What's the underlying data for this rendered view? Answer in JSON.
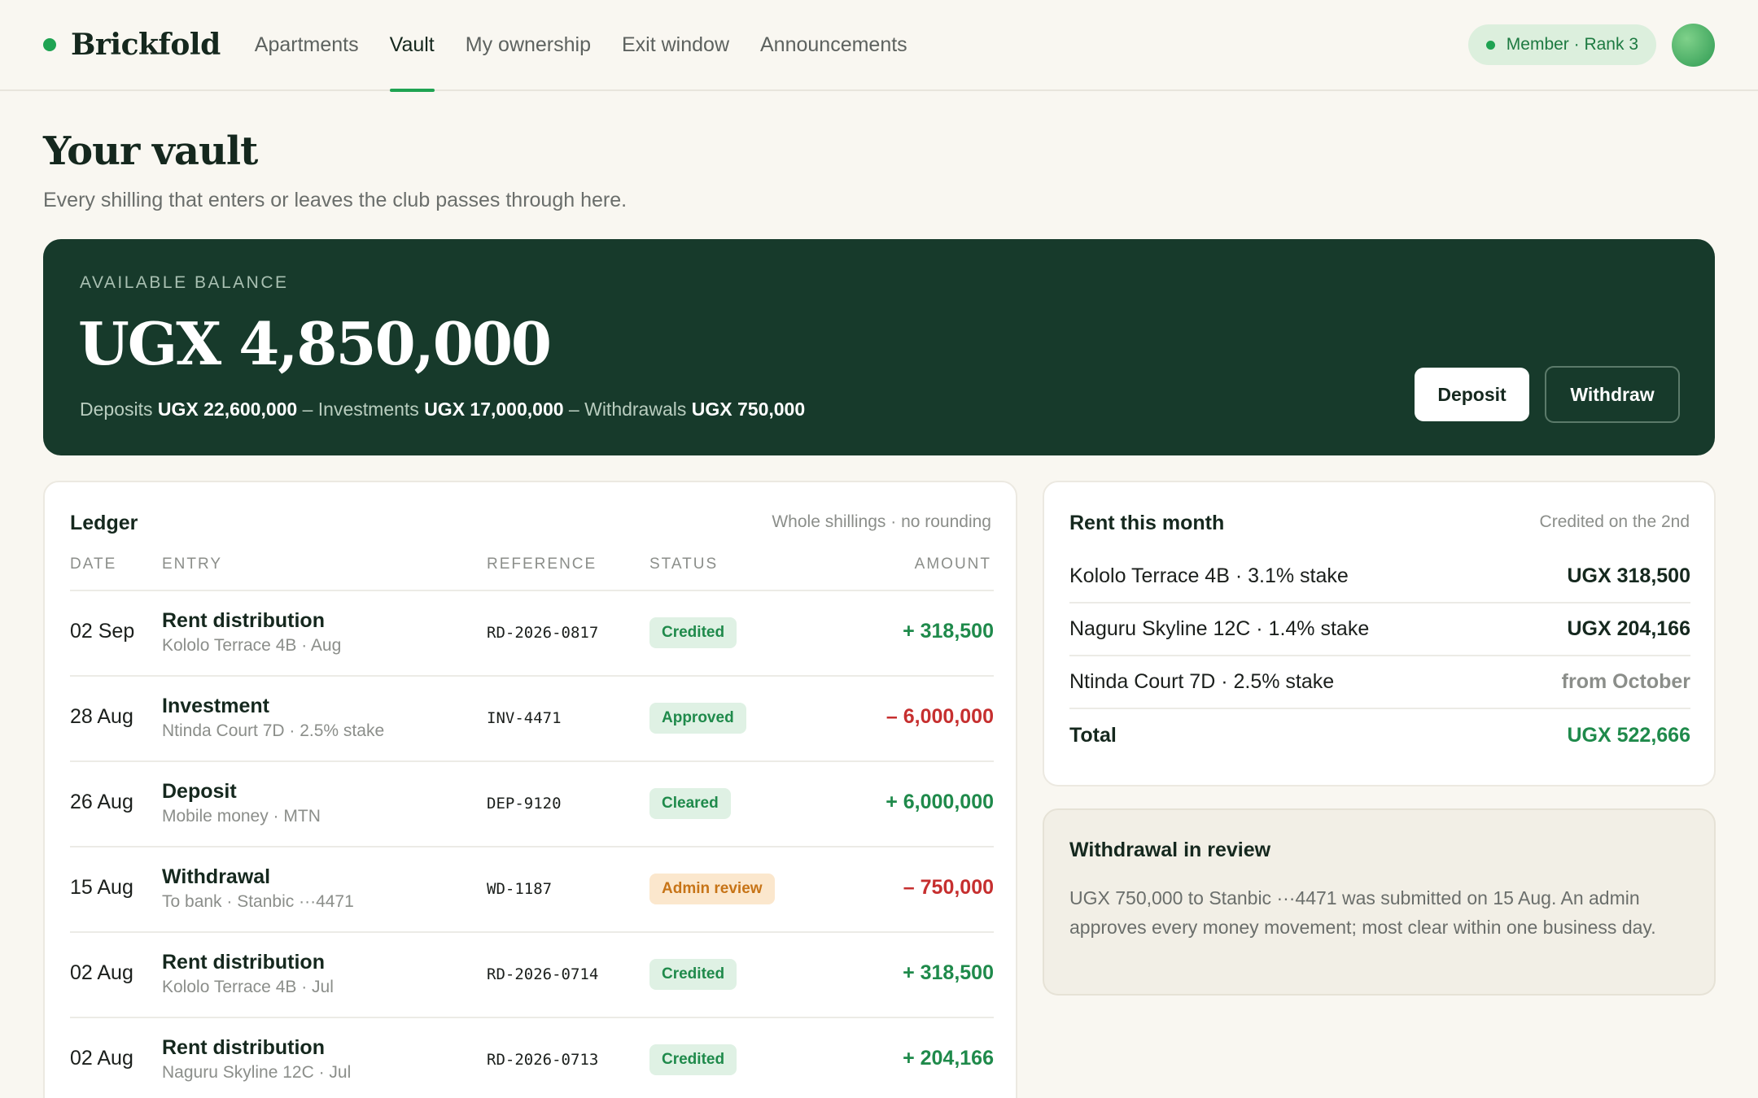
{
  "brand": {
    "name": "Brickfold"
  },
  "nav": {
    "items": [
      {
        "label": "Apartments"
      },
      {
        "label": "Vault"
      },
      {
        "label": "My ownership"
      },
      {
        "label": "Exit window"
      },
      {
        "label": "Announcements"
      }
    ],
    "active": "Vault"
  },
  "member": {
    "badge": "Member · Rank 3"
  },
  "page": {
    "title": "Your vault",
    "subtitle": "Every shilling that enters or leaves the club passes through here."
  },
  "balance": {
    "label": "AVAILABLE BALANCE",
    "amount": "UGX 4,850,000",
    "deposits_label": "Deposits",
    "deposits_value": "UGX 22,600,000",
    "investments_label": "Investments",
    "investments_value": "UGX 17,000,000",
    "withdrawals_label": "Withdrawals",
    "withdrawals_value": "UGX 750,000",
    "separator": "–",
    "deposit_button": "Deposit",
    "withdraw_button": "Withdraw"
  },
  "ledger": {
    "title": "Ledger",
    "note": "Whole shillings · no rounding",
    "columns": {
      "date": "DATE",
      "entry": "ENTRY",
      "reference": "REFERENCE",
      "status": "STATUS",
      "amount": "AMOUNT"
    },
    "rows": [
      {
        "date": "02 Sep",
        "title": "Rent distribution",
        "sub": "Kololo Terrace 4B · Aug",
        "ref": "RD-2026-0817",
        "status": "Credited",
        "amount": "+ 318,500"
      },
      {
        "date": "28 Aug",
        "title": "Investment",
        "sub": "Ntinda Court 7D · 2.5% stake",
        "ref": "INV-4471",
        "status": "Approved",
        "amount": "– 6,000,000"
      },
      {
        "date": "26 Aug",
        "title": "Deposit",
        "sub": "Mobile money · MTN",
        "ref": "DEP-9120",
        "status": "Cleared",
        "amount": "+ 6,000,000"
      },
      {
        "date": "15 Aug",
        "title": "Withdrawal",
        "sub": "To bank · Stanbic ···4471",
        "ref": "WD-1187",
        "status": "Admin review",
        "amount": "– 750,000"
      },
      {
        "date": "02 Aug",
        "title": "Rent distribution",
        "sub": "Kololo Terrace 4B · Jul",
        "ref": "RD-2026-0714",
        "status": "Credited",
        "amount": "+ 318,500"
      },
      {
        "date": "02 Aug",
        "title": "Rent distribution",
        "sub": "Naguru Skyline 12C · Jul",
        "ref": "RD-2026-0713",
        "status": "Credited",
        "amount": "+ 204,166"
      }
    ]
  },
  "rent": {
    "title": "Rent this month",
    "note": "Credited on the 2nd",
    "rows": [
      {
        "name": "Kololo Terrace 4B · 3.1% stake",
        "value": "UGX 318,500"
      },
      {
        "name": "Naguru Skyline 12C · 1.4% stake",
        "value": "UGX 204,166"
      },
      {
        "name": "Ntinda Court 7D · 2.5% stake",
        "value": "from October"
      }
    ],
    "total_label": "Total",
    "total_value": "UGX 522,666"
  },
  "review": {
    "title": "Withdrawal in review",
    "body": "UGX 750,000 to Stanbic ···4471 was submitted on 15 Aug. An admin approves every money movement; most clear within one business day."
  },
  "colors": {
    "accent": "#1fa352",
    "balance_card": "#173a2b",
    "positive": "#1f8a4b",
    "negative": "#c62f2f",
    "review_badge": "#c77417"
  }
}
